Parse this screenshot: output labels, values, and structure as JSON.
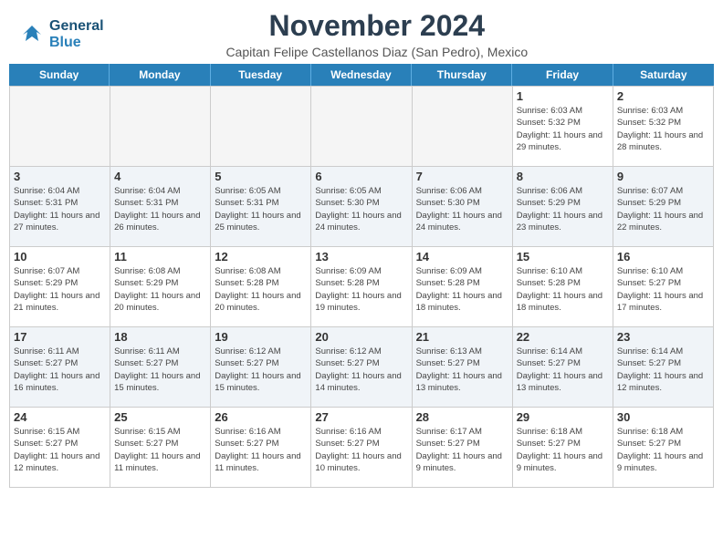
{
  "header": {
    "logo_line1": "General",
    "logo_line2": "Blue",
    "month_title": "November 2024",
    "subtitle": "Capitan Felipe Castellanos Diaz (San Pedro), Mexico"
  },
  "calendar": {
    "headers": [
      "Sunday",
      "Monday",
      "Tuesday",
      "Wednesday",
      "Thursday",
      "Friday",
      "Saturday"
    ],
    "rows": [
      [
        {
          "day": "",
          "info": "",
          "empty": true
        },
        {
          "day": "",
          "info": "",
          "empty": true
        },
        {
          "day": "",
          "info": "",
          "empty": true
        },
        {
          "day": "",
          "info": "",
          "empty": true
        },
        {
          "day": "",
          "info": "",
          "empty": true
        },
        {
          "day": "1",
          "info": "Sunrise: 6:03 AM\nSunset: 5:32 PM\nDaylight: 11 hours\nand 29 minutes."
        },
        {
          "day": "2",
          "info": "Sunrise: 6:03 AM\nSunset: 5:32 PM\nDaylight: 11 hours\nand 28 minutes."
        }
      ],
      [
        {
          "day": "3",
          "info": "Sunrise: 6:04 AM\nSunset: 5:31 PM\nDaylight: 11 hours\nand 27 minutes."
        },
        {
          "day": "4",
          "info": "Sunrise: 6:04 AM\nSunset: 5:31 PM\nDaylight: 11 hours\nand 26 minutes."
        },
        {
          "day": "5",
          "info": "Sunrise: 6:05 AM\nSunset: 5:31 PM\nDaylight: 11 hours\nand 25 minutes."
        },
        {
          "day": "6",
          "info": "Sunrise: 6:05 AM\nSunset: 5:30 PM\nDaylight: 11 hours\nand 24 minutes."
        },
        {
          "day": "7",
          "info": "Sunrise: 6:06 AM\nSunset: 5:30 PM\nDaylight: 11 hours\nand 24 minutes."
        },
        {
          "day": "8",
          "info": "Sunrise: 6:06 AM\nSunset: 5:29 PM\nDaylight: 11 hours\nand 23 minutes."
        },
        {
          "day": "9",
          "info": "Sunrise: 6:07 AM\nSunset: 5:29 PM\nDaylight: 11 hours\nand 22 minutes."
        }
      ],
      [
        {
          "day": "10",
          "info": "Sunrise: 6:07 AM\nSunset: 5:29 PM\nDaylight: 11 hours\nand 21 minutes."
        },
        {
          "day": "11",
          "info": "Sunrise: 6:08 AM\nSunset: 5:29 PM\nDaylight: 11 hours\nand 20 minutes."
        },
        {
          "day": "12",
          "info": "Sunrise: 6:08 AM\nSunset: 5:28 PM\nDaylight: 11 hours\nand 20 minutes."
        },
        {
          "day": "13",
          "info": "Sunrise: 6:09 AM\nSunset: 5:28 PM\nDaylight: 11 hours\nand 19 minutes."
        },
        {
          "day": "14",
          "info": "Sunrise: 6:09 AM\nSunset: 5:28 PM\nDaylight: 11 hours\nand 18 minutes."
        },
        {
          "day": "15",
          "info": "Sunrise: 6:10 AM\nSunset: 5:28 PM\nDaylight: 11 hours\nand 18 minutes."
        },
        {
          "day": "16",
          "info": "Sunrise: 6:10 AM\nSunset: 5:27 PM\nDaylight: 11 hours\nand 17 minutes."
        }
      ],
      [
        {
          "day": "17",
          "info": "Sunrise: 6:11 AM\nSunset: 5:27 PM\nDaylight: 11 hours\nand 16 minutes."
        },
        {
          "day": "18",
          "info": "Sunrise: 6:11 AM\nSunset: 5:27 PM\nDaylight: 11 hours\nand 15 minutes."
        },
        {
          "day": "19",
          "info": "Sunrise: 6:12 AM\nSunset: 5:27 PM\nDaylight: 11 hours\nand 15 minutes."
        },
        {
          "day": "20",
          "info": "Sunrise: 6:12 AM\nSunset: 5:27 PM\nDaylight: 11 hours\nand 14 minutes."
        },
        {
          "day": "21",
          "info": "Sunrise: 6:13 AM\nSunset: 5:27 PM\nDaylight: 11 hours\nand 13 minutes."
        },
        {
          "day": "22",
          "info": "Sunrise: 6:14 AM\nSunset: 5:27 PM\nDaylight: 11 hours\nand 13 minutes."
        },
        {
          "day": "23",
          "info": "Sunrise: 6:14 AM\nSunset: 5:27 PM\nDaylight: 11 hours\nand 12 minutes."
        }
      ],
      [
        {
          "day": "24",
          "info": "Sunrise: 6:15 AM\nSunset: 5:27 PM\nDaylight: 11 hours\nand 12 minutes."
        },
        {
          "day": "25",
          "info": "Sunrise: 6:15 AM\nSunset: 5:27 PM\nDaylight: 11 hours\nand 11 minutes."
        },
        {
          "day": "26",
          "info": "Sunrise: 6:16 AM\nSunset: 5:27 PM\nDaylight: 11 hours\nand 11 minutes."
        },
        {
          "day": "27",
          "info": "Sunrise: 6:16 AM\nSunset: 5:27 PM\nDaylight: 11 hours\nand 10 minutes."
        },
        {
          "day": "28",
          "info": "Sunrise: 6:17 AM\nSunset: 5:27 PM\nDaylight: 11 hours\nand 9 minutes."
        },
        {
          "day": "29",
          "info": "Sunrise: 6:18 AM\nSunset: 5:27 PM\nDaylight: 11 hours\nand 9 minutes."
        },
        {
          "day": "30",
          "info": "Sunrise: 6:18 AM\nSunset: 5:27 PM\nDaylight: 11 hours\nand 9 minutes."
        }
      ]
    ]
  }
}
